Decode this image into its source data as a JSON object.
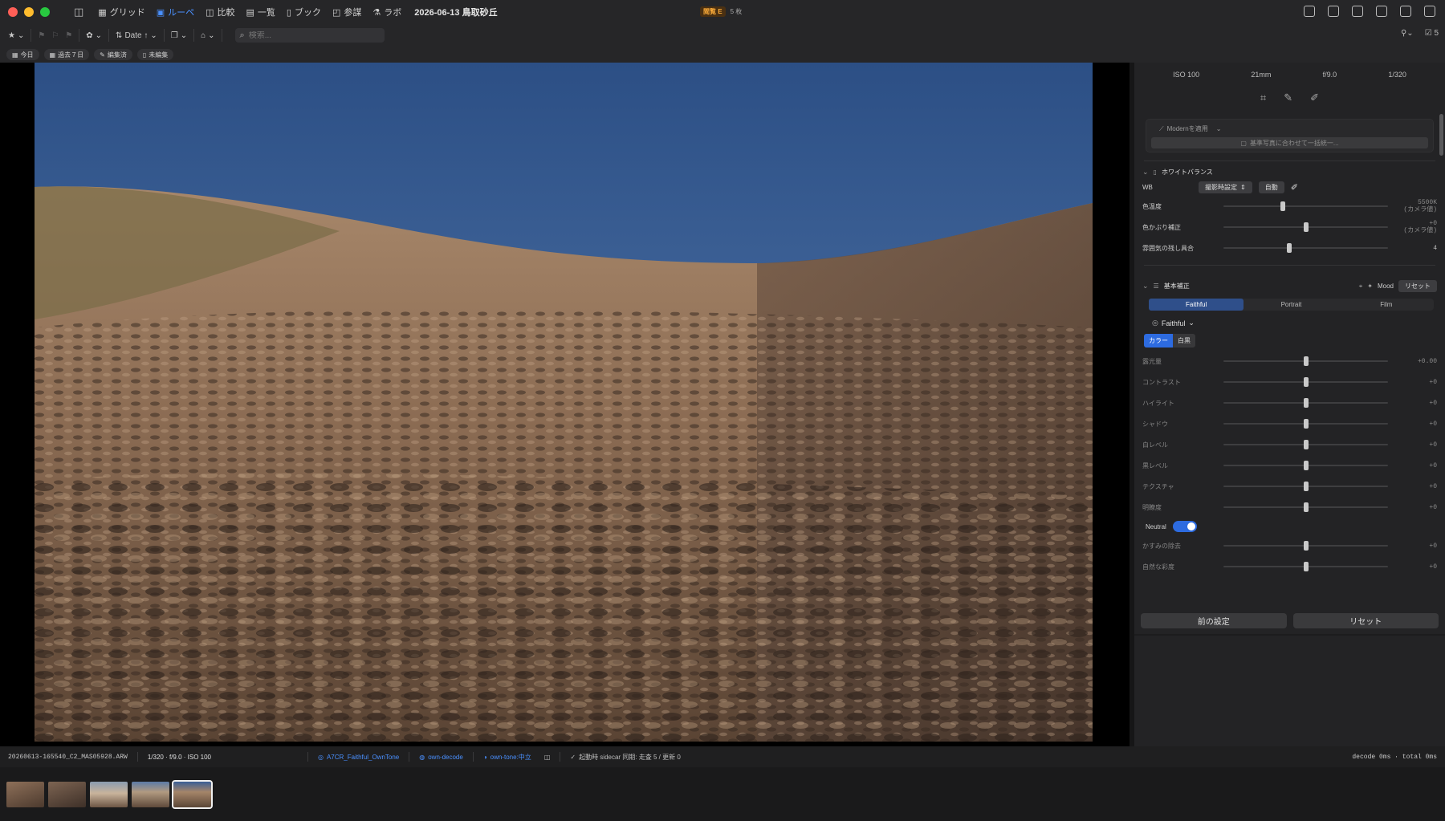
{
  "titlebar": {
    "modes": [
      {
        "label": "グリッド",
        "glyph": "▦",
        "active": false,
        "icon": "grid-icon"
      },
      {
        "label": "ルーペ",
        "glyph": "▣",
        "active": true,
        "icon": "loupe-icon"
      },
      {
        "label": "比較",
        "glyph": "◫",
        "active": false,
        "icon": "compare-icon"
      },
      {
        "label": "一覧",
        "glyph": "▤",
        "active": false,
        "icon": "list-icon"
      },
      {
        "label": "ブック",
        "glyph": "▯",
        "active": false,
        "icon": "book-icon"
      },
      {
        "label": "参謀",
        "glyph": "◰",
        "active": false,
        "icon": "advisor-icon"
      },
      {
        "label": "ラボ",
        "glyph": "⚗",
        "active": false,
        "icon": "lab-icon"
      }
    ],
    "title": "2026-06-13 鳥取砂丘",
    "badge": "閲覧 E",
    "count": "5 枚"
  },
  "toolbar": {
    "sort_label": "Date ↑",
    "search_placeholder": "検索...",
    "count_right": "5"
  },
  "chips": [
    {
      "label": "今日",
      "icon": "calendar-icon"
    },
    {
      "label": "過去７日",
      "icon": "calendar-range-icon"
    },
    {
      "label": "編集済",
      "icon": "pencil-icon"
    },
    {
      "label": "未編集",
      "icon": "document-icon"
    }
  ],
  "panel": {
    "exif": [
      "ISO 100",
      "21mm",
      "f/9.0",
      "1/320"
    ],
    "ai_apply": "Modernを適用",
    "ai_hint": "基準写真に合わせて一括統一...",
    "wb": {
      "title": "ホワイトバランス",
      "wb_label": "WB",
      "wb_value": "撮影時設定",
      "auto": "自動",
      "rows": [
        {
          "label": "色温度",
          "val": "5500K",
          "sub": "(カメラ値)",
          "pos": 0.36
        },
        {
          "label": "色かぶり補正",
          "val": "+0",
          "sub": "(カメラ値)",
          "pos": 0.5
        },
        {
          "label": "雰囲気の残し具合",
          "val": "4",
          "sub": "",
          "pos": 0.4
        }
      ]
    },
    "basic": {
      "title": "基本補正",
      "mood": "Mood",
      "reset": "リセット",
      "tabs": [
        "Faithful",
        "Portrait",
        "Film"
      ],
      "active_tab": 0,
      "profile": "Faithful",
      "color_modes": [
        "カラー",
        "白黒"
      ],
      "rows": [
        {
          "label": "露光量",
          "val": "+0.00",
          "pos": 0.5
        },
        {
          "label": "コントラスト",
          "val": "+0",
          "pos": 0.5
        },
        {
          "label": "ハイライト",
          "val": "+0",
          "pos": 0.5
        },
        {
          "label": "シャドウ",
          "val": "+0",
          "pos": 0.5
        },
        {
          "label": "白レベル",
          "val": "+0",
          "pos": 0.5
        },
        {
          "label": "黒レベル",
          "val": "+0",
          "pos": 0.5
        },
        {
          "label": "テクスチャ",
          "val": "+0",
          "pos": 0.5
        },
        {
          "label": "明瞭度",
          "val": "+0",
          "pos": 0.5
        }
      ],
      "neutral_label": "Neutral",
      "rows2": [
        {
          "label": "かすみの除去",
          "val": "+0",
          "pos": 0.5
        },
        {
          "label": "自然な彩度",
          "val": "+0",
          "pos": 0.5
        }
      ]
    },
    "prev_settings": "前の設定",
    "reset_all": "リセット"
  },
  "status": {
    "filename": "20260613-165540_C2_MAS05928.ARW",
    "exposure": "1/320 · f/9.0 · ISO 100",
    "profile": "A7CR_Faithful_OwnTone",
    "decode": "own-decode",
    "tone": "own-tone:中立",
    "sidecar": "起動時 sidecar 同期: 走査 5 / 更新 0",
    "perf": "decode 0ms · total 0ms"
  },
  "filmstrip": {
    "count": 5,
    "selected": 4
  }
}
